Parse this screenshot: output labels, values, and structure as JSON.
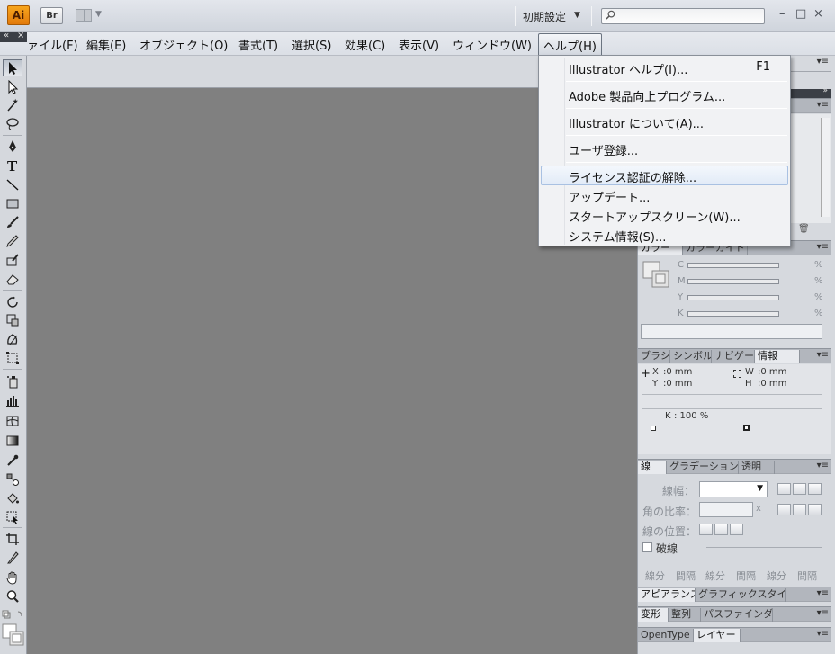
{
  "titlebar": {
    "app_logo": "Ai",
    "bridge_button": "Br",
    "workspace": "初期設定",
    "search_placeholder": "",
    "win_minimize": "–",
    "win_restore": "□",
    "win_close": "×"
  },
  "menubar": {
    "items": [
      {
        "label": "ァイル(F)"
      },
      {
        "label": "編集(E)"
      },
      {
        "label": "オブジェクト(O)"
      },
      {
        "label": "書式(T)"
      },
      {
        "label": "選択(S)"
      },
      {
        "label": "効果(C)"
      },
      {
        "label": "表示(V)"
      },
      {
        "label": "ウィンドウ(W)"
      },
      {
        "label": "ヘルプ(H)"
      }
    ],
    "collapse_left": "«",
    "collapse_close": "×"
  },
  "help_menu": {
    "items": [
      {
        "label": "Illustrator ヘルプ(I)...",
        "shortcut": "F1"
      },
      {
        "label": "Adobe 製品向上プログラム..."
      },
      {
        "label": "Illustrator について(A)..."
      },
      {
        "label": "ユーザ登録..."
      },
      {
        "label": "ライセンス認証の解除..."
      },
      {
        "label": "アップデート..."
      },
      {
        "label": "スタートアップスクリーン(W)..."
      },
      {
        "label": "システム情報(S)..."
      }
    ]
  },
  "panels": {
    "color": {
      "tabs": [
        "カラー",
        "カラーガイド"
      ],
      "channels": [
        "C",
        "M",
        "Y",
        "K"
      ],
      "percent": "%"
    },
    "info": {
      "tabs": [
        "ブラシ",
        "シンボル",
        "ナビゲータ",
        "情報"
      ],
      "x_label": "X",
      "x_value": ":0 mm",
      "y_label": "Y",
      "y_value": ":0 mm",
      "w_label": "W",
      "w_value": ":0 mm",
      "h_label": "H",
      "h_value": ":0 mm",
      "k_label": "K",
      "k_value": ": 100 %"
    },
    "stroke": {
      "tabs": [
        "線",
        "グラデーション",
        "透明"
      ],
      "weight_label": "線幅：",
      "miter_label": "角の比率：",
      "miter_unit": "x",
      "align_label": "線の位置：",
      "dashed_label": "破線",
      "dash_labels": [
        "線分",
        "間隔",
        "線分",
        "間隔",
        "線分",
        "間隔"
      ]
    },
    "appearance": {
      "tabs": [
        "アピアランス",
        "グラフィックスタイル"
      ]
    },
    "transform": {
      "tabs": [
        "変形",
        "整列",
        "パスファインダ"
      ]
    },
    "layers": {
      "tabs": [
        "OpenType",
        "レイヤー"
      ]
    },
    "menu_icon": "▾≡",
    "collapse_icon": "»"
  }
}
